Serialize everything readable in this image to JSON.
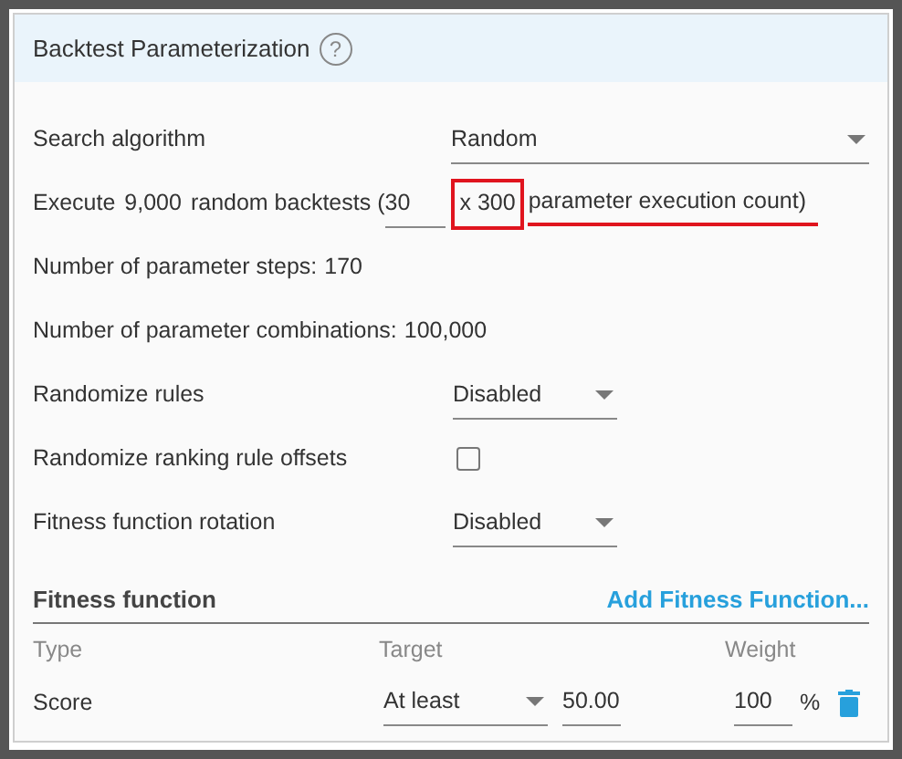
{
  "panel": {
    "title": "Backtest Parameterization",
    "help_icon": "?"
  },
  "search_algorithm": {
    "label": "Search algorithm",
    "value": "Random"
  },
  "execute": {
    "prefix": "Execute",
    "count": "9,000",
    "middle": "random backtests (",
    "field_value": "30",
    "times": "x 300",
    "suffix": "parameter execution count)"
  },
  "parameter_steps": {
    "label": "Number of parameter steps:",
    "value": "170"
  },
  "parameter_combinations": {
    "label": "Number of parameter combinations:",
    "value": "100,000"
  },
  "randomize_rules": {
    "label": "Randomize rules",
    "value": "Disabled"
  },
  "randomize_offsets": {
    "label": "Randomize ranking rule offsets",
    "checked": false
  },
  "fitness_rotation": {
    "label": "Fitness function rotation",
    "value": "Disabled"
  },
  "fitness": {
    "title": "Fitness function",
    "add_link": "Add Fitness Function...",
    "columns": [
      "Type",
      "Target",
      "Weight"
    ],
    "rows": [
      {
        "type": "Score",
        "target": "At least",
        "target_value": "50.00",
        "weight": "100",
        "unit": "%"
      }
    ]
  }
}
